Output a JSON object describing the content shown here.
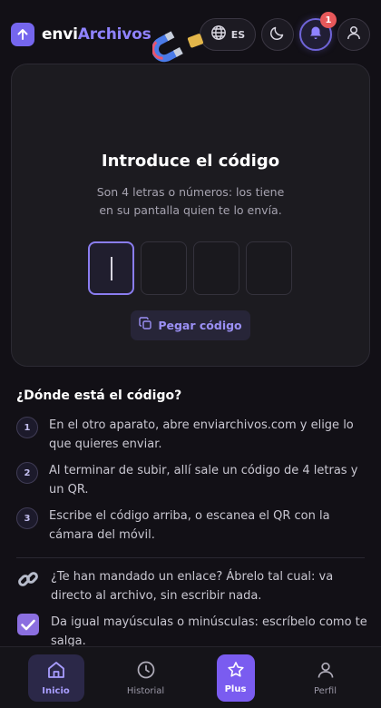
{
  "app": {
    "brand_plain": "envi",
    "brand_accent": "Archivos"
  },
  "header": {
    "language": "ES",
    "notifications_count": "1",
    "icons": {
      "language": "globe-icon",
      "theme": "moon-icon",
      "notifications": "bell-icon",
      "account": "user-icon"
    }
  },
  "card": {
    "title": "Introduce el código",
    "subtitle_line1": "Son 4 letras o números: los tiene",
    "subtitle_line2": "en su pantalla quien te lo envía.",
    "code_values": [
      "",
      "",
      "",
      ""
    ],
    "paste_label": "Pegar código"
  },
  "help": {
    "title": "¿Dónde está el código?",
    "steps": [
      {
        "num": "1",
        "text": "En el otro aparato, abre enviarchivos.com y elige lo que quieres enviar."
      },
      {
        "num": "2",
        "text": "Al terminar de subir, allí sale un código de 4 letras y un QR."
      },
      {
        "num": "3",
        "text": "Escribe el código arriba, o escanea el QR con la cámara del móvil."
      }
    ],
    "tips": [
      {
        "icon": "link-icon",
        "text": "¿Te han mandado un enlace? Ábrelo tal cual: va directo al archivo, sin escribir nada."
      },
      {
        "icon": "check-box-icon",
        "text": "Da igual mayúsculas o minúsculas: escríbelo como te salga."
      }
    ]
  },
  "nav": {
    "items": [
      {
        "label": "Inicio",
        "icon": "home-icon",
        "active": true
      },
      {
        "label": "Historial",
        "icon": "clock-icon",
        "active": false
      },
      {
        "label": "Plus",
        "icon": "star-icon",
        "active": false
      },
      {
        "label": "Perfil",
        "icon": "user-icon",
        "active": false
      }
    ]
  },
  "colors": {
    "accent": "#7566ee",
    "background": "#121016",
    "card": "#1c1b20",
    "badge": "#e7585a"
  }
}
